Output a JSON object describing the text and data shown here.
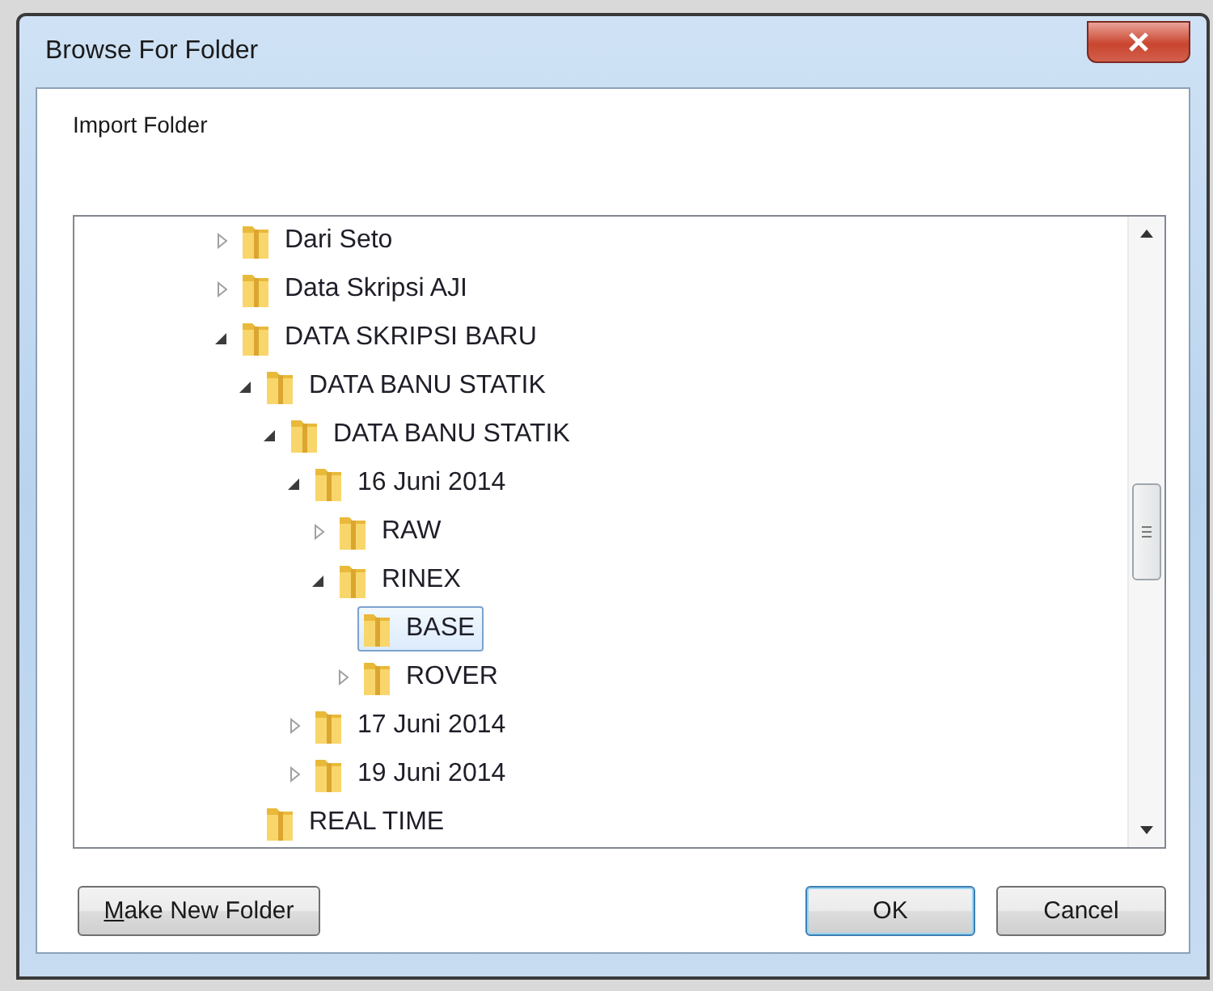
{
  "window": {
    "title": "Browse For Folder"
  },
  "instruction": "Import Folder",
  "tree": [
    {
      "label": "Dari Seto",
      "expanded": false,
      "selected": false
    },
    {
      "label": "Data Skripsi AJI",
      "expanded": false,
      "selected": false
    },
    {
      "label": "DATA SKRIPSI BARU",
      "expanded": true,
      "selected": false,
      "children": [
        {
          "label": "DATA BANU STATIK",
          "expanded": true,
          "selected": false,
          "children": [
            {
              "label": "DATA BANU STATIK",
              "expanded": true,
              "selected": false,
              "children": [
                {
                  "label": "16 Juni 2014",
                  "expanded": true,
                  "selected": false,
                  "children": [
                    {
                      "label": "RAW",
                      "expanded": false,
                      "selected": false
                    },
                    {
                      "label": "RINEX",
                      "expanded": true,
                      "selected": false,
                      "children": [
                        {
                          "label": "BASE",
                          "selected": true
                        },
                        {
                          "label": "ROVER",
                          "expanded": false,
                          "selected": false
                        }
                      ]
                    }
                  ]
                },
                {
                  "label": "17 Juni 2014",
                  "expanded": false,
                  "selected": false
                },
                {
                  "label": "19 Juni 2014",
                  "expanded": false,
                  "selected": false
                }
              ]
            }
          ]
        },
        {
          "label": "REAL TIME",
          "selected": false
        }
      ]
    }
  ],
  "buttons": [
    {
      "label": "Make New Folder",
      "kind": "mnemonic",
      "default": false
    },
    {
      "label": "OK",
      "kind": "plain",
      "default": true
    },
    {
      "label": "Cancel",
      "kind": "plain",
      "default": false
    }
  ]
}
